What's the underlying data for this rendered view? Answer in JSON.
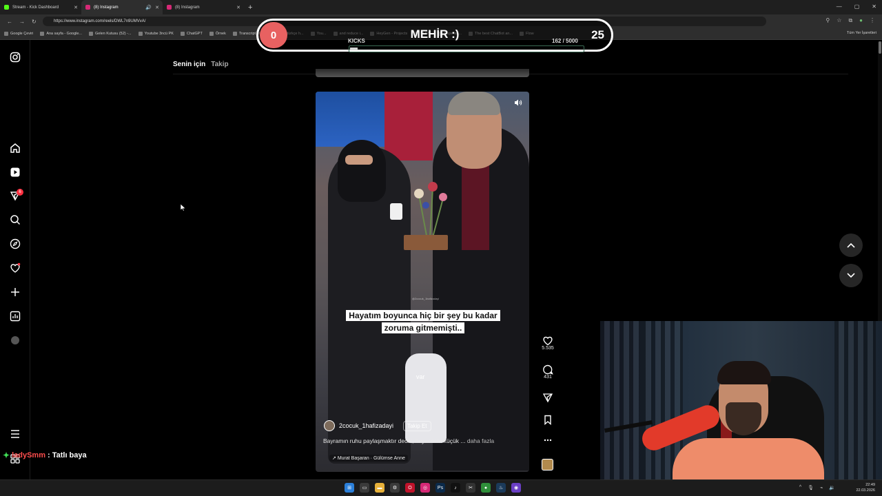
{
  "browser": {
    "tabs": [
      {
        "title": "Stream - Kick Dashboard",
        "active": false
      },
      {
        "title": "(8) Instagram",
        "active": true
      },
      {
        "title": "(8) Instagram",
        "active": false
      }
    ],
    "url": "https://www.instagram.com/reels/DWL7n9UMVvA/",
    "bookmarks": [
      "Google Çeviri",
      "Ana sayfa - Google...",
      "Gelen Kutusu (52) -...",
      "Youtube 3ncü PK",
      "ChatGPT",
      "Örnek",
      "Transcript of \"MI M...",
      "türkçe h...",
      "You...",
      "and reduce i...",
      "HeyGen - Projects",
      "BURÇ",
      "Esperan...",
      "The best ChatBot an...",
      "Flow"
    ],
    "bookmarks_right": "Tüm Yer İşaretleri"
  },
  "overlay": {
    "left_count": "0",
    "title": "MEHİR :)",
    "right_count": "25",
    "kicks_label": "KICKS",
    "kicks_progress": "162  / 5000",
    "kicks_fraction": 0.032
  },
  "instagram": {
    "feed_tabs": {
      "for_you": "Senin için",
      "following": "Takip"
    },
    "notification_badge": "6",
    "reel": {
      "subtitle_line1": "Hayatım boyunca hiç bir şey bu kadar",
      "subtitle_line2": "zoruma gitmemişti..",
      "watermark": "@2cocuk_1hafizadayi",
      "spoken": "var",
      "author": "2cocuk_1hafizadayi",
      "follow_label": "Takip Et",
      "caption": "Bayramın ruhu paylaşmaktır dedik, heyecanla küçük ...",
      "caption_more": "daha fazla",
      "music": "Murat Başaran · Gülümse Anne"
    },
    "actions": {
      "likes": "5.535",
      "comments": "431"
    }
  },
  "chat": {
    "user": "ladySmm",
    "message": ": Tatlı baya"
  },
  "taskbar": {
    "time": "22:49",
    "date": "22.03.2026"
  },
  "colors": {
    "kick_green": "#53fc18",
    "badge_red": "#ff3040",
    "overlay_red": "#e86161"
  }
}
